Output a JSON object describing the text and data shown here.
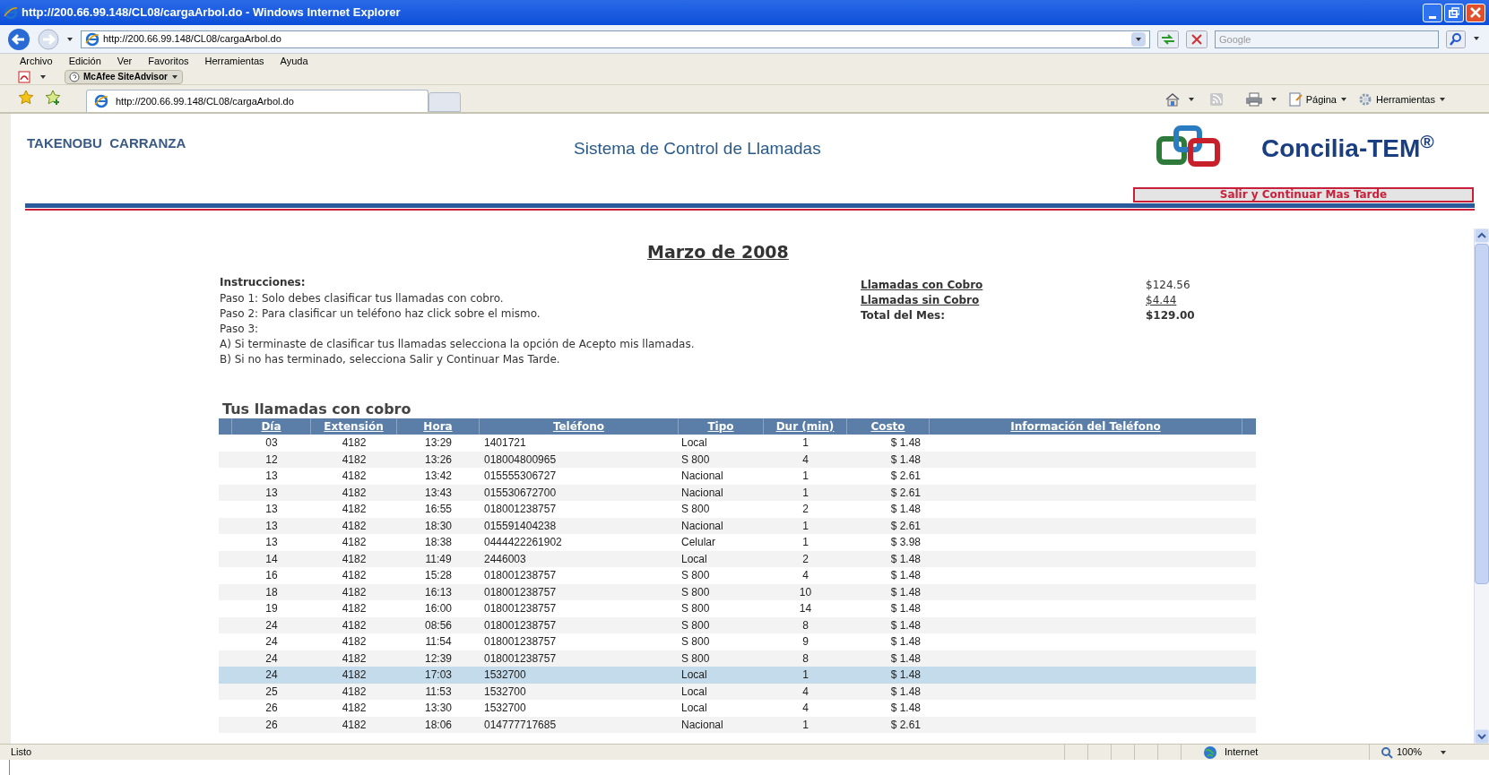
{
  "window": {
    "title": "http://200.66.99.148/CL08/cargaArbol.do - Windows Internet Explorer"
  },
  "address_bar": {
    "url": "http://200.66.99.148/CL08/cargaArbol.do"
  },
  "search": {
    "placeholder": "Google"
  },
  "menu": [
    "Archivo",
    "Edición",
    "Ver",
    "Favoritos",
    "Herramientas",
    "Ayuda"
  ],
  "toolbar": {
    "siteadvisor": "McAfee SiteAdvisor"
  },
  "tab": {
    "label": "http://200.66.99.148/CL08/cargaArbol.do"
  },
  "command_bar": [
    "Página",
    "Herramientas"
  ],
  "page": {
    "user": "TAKENOBU  CARRANZA",
    "system_title": "Sistema de Control de Llamadas",
    "brand": "Concilia-TEM",
    "brand_mark": "®",
    "exit_button": "Salir y Continuar Mas Tarde",
    "month": "Marzo de 2008",
    "instructions_title": "Instrucciones:",
    "instructions": [
      "Paso 1: Solo debes clasificar tus llamadas con cobro.",
      "Paso 2: Para clasificar un teléfono haz click sobre el mismo.",
      "Paso 3:",
      "A) Si terminaste de clasificar tus llamadas selecciona la opción de Acepto mis llamadas.",
      "B) Si no has terminado, selecciona Salir y Continuar Mas Tarde."
    ],
    "summary": [
      {
        "label": "Llamadas con Cobro",
        "value": "$124.56",
        "kind": "link"
      },
      {
        "label": "Llamadas sin Cobro",
        "value": "$4.44",
        "kind": "link"
      },
      {
        "label": "Total del Mes:",
        "value": "$129.00",
        "kind": "total"
      }
    ],
    "table_title": "Tus llamadas con cobro",
    "table": {
      "columns": [
        "Día",
        "Extensión",
        "Hora",
        "Teléfono",
        "Tipo",
        "Dur (min)",
        "Costo",
        "Información del Teléfono"
      ],
      "rows": [
        {
          "cells": [
            "03",
            "4182",
            "13:29",
            "1401721",
            "Local",
            "1",
            "$ 1.48"
          ],
          "selected": false
        },
        {
          "cells": [
            "12",
            "4182",
            "13:26",
            "018004800965",
            "S 800",
            "4",
            "$ 1.48"
          ],
          "selected": false
        },
        {
          "cells": [
            "13",
            "4182",
            "13:42",
            "015555306727",
            "Nacional",
            "1",
            "$ 2.61"
          ],
          "selected": false
        },
        {
          "cells": [
            "13",
            "4182",
            "13:43",
            "015530672700",
            "Nacional",
            "1",
            "$ 2.61"
          ],
          "selected": false
        },
        {
          "cells": [
            "13",
            "4182",
            "16:55",
            "018001238757",
            "S 800",
            "2",
            "$ 1.48"
          ],
          "selected": false
        },
        {
          "cells": [
            "13",
            "4182",
            "18:30",
            "015591404238",
            "Nacional",
            "1",
            "$ 2.61"
          ],
          "selected": false
        },
        {
          "cells": [
            "13",
            "4182",
            "18:38",
            "0444422261902",
            "Celular",
            "1",
            "$ 3.98"
          ],
          "selected": false
        },
        {
          "cells": [
            "14",
            "4182",
            "11:49",
            "2446003",
            "Local",
            "2",
            "$ 1.48"
          ],
          "selected": false
        },
        {
          "cells": [
            "16",
            "4182",
            "15:28",
            "018001238757",
            "S 800",
            "4",
            "$ 1.48"
          ],
          "selected": false
        },
        {
          "cells": [
            "18",
            "4182",
            "16:13",
            "018001238757",
            "S 800",
            "10",
            "$ 1.48"
          ],
          "selected": false
        },
        {
          "cells": [
            "19",
            "4182",
            "16:00",
            "018001238757",
            "S 800",
            "14",
            "$ 1.48"
          ],
          "selected": false
        },
        {
          "cells": [
            "24",
            "4182",
            "08:56",
            "018001238757",
            "S 800",
            "8",
            "$ 1.48"
          ],
          "selected": false
        },
        {
          "cells": [
            "24",
            "4182",
            "11:54",
            "018001238757",
            "S 800",
            "9",
            "$ 1.48"
          ],
          "selected": false
        },
        {
          "cells": [
            "24",
            "4182",
            "12:39",
            "018001238757",
            "S 800",
            "8",
            "$ 1.48"
          ],
          "selected": false
        },
        {
          "cells": [
            "24",
            "4182",
            "17:03",
            "1532700",
            "Local",
            "1",
            "$ 1.48"
          ],
          "selected": true
        },
        {
          "cells": [
            "25",
            "4182",
            "11:53",
            "1532700",
            "Local",
            "4",
            "$ 1.48"
          ],
          "selected": false
        },
        {
          "cells": [
            "26",
            "4182",
            "13:30",
            "1532700",
            "Local",
            "4",
            "$ 1.48"
          ],
          "selected": false
        },
        {
          "cells": [
            "26",
            "4182",
            "18:06",
            "014777717685",
            "Nacional",
            "1",
            "$ 2.61"
          ],
          "selected": false
        }
      ]
    }
  },
  "status_bar": {
    "text": "Listo",
    "zone": "Internet",
    "zoom": "100%"
  }
}
